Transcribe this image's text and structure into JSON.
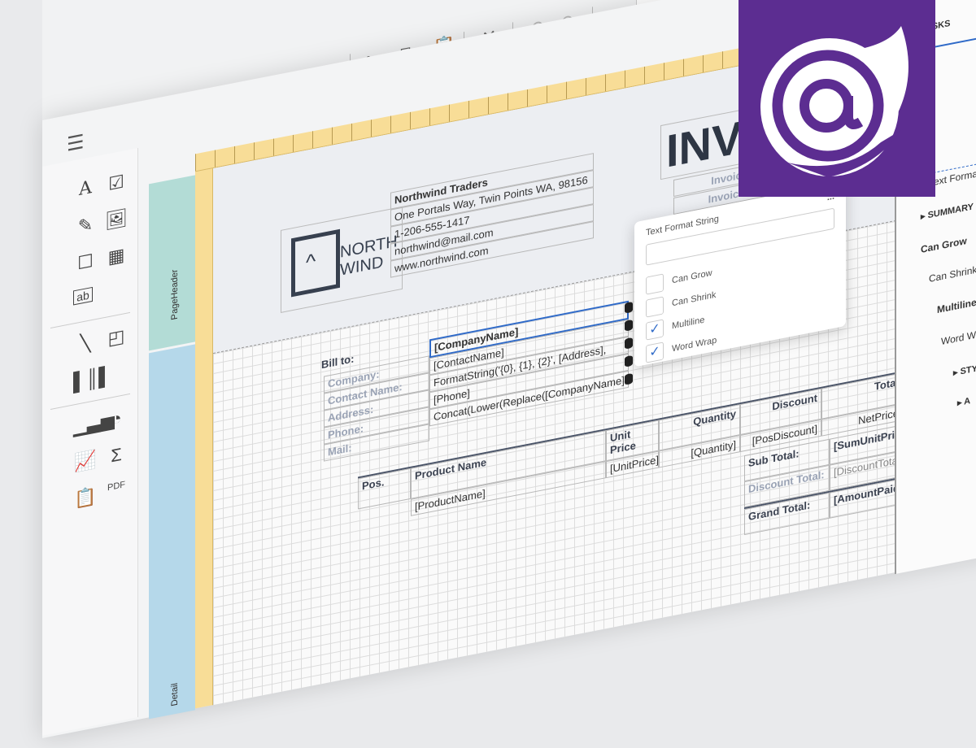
{
  "toolbar": {
    "icons": [
      "cut-icon",
      "copy-icon",
      "paste-icon",
      "delete-icon",
      "undo-icon",
      "redo-icon",
      "zoom-out-icon"
    ]
  },
  "toolbox": {
    "icons": [
      "label-icon",
      "checkbox-icon",
      "rich-text-icon",
      "picture-icon",
      "panel-icon",
      "table-icon",
      "character-comb-icon",
      "line-icon",
      "shape-icon",
      "barcode-icon",
      "chart-icon",
      "gauge-icon",
      "sparkline-icon",
      "summary-icon",
      "subreport-icon",
      "pdf-content-icon"
    ]
  },
  "bands": {
    "page_header": "PageHeader",
    "detail": "Detail"
  },
  "company": {
    "logo_top": "NORTH",
    "logo_bottom": "WIND",
    "name": "Northwind Traders",
    "address": "One Portals Way, Twin Points WA, 98156",
    "phone": "1-206-555-1417",
    "email": "northwind@mail.com",
    "web": "www.northwind.com"
  },
  "invoice": {
    "title": "INVOICE",
    "row1": "Invoic",
    "row2": "Invoice"
  },
  "bill": {
    "title": "Bill to:",
    "labels": [
      "Company:",
      "Contact Name:",
      "Address:",
      "Phone:",
      "Mail:"
    ],
    "fields": [
      "[CompanyName]",
      "[ContactName]",
      "FormatString('{0}, {1}, {2}', [Address],",
      "[Phone]",
      "Concat(Lower(Replace([CompanyName],"
    ]
  },
  "table": {
    "headers": [
      "Pos.",
      "Product Name",
      "Unit Price",
      "Quantity",
      "Discount",
      "Total"
    ],
    "values": [
      "[ProductName]",
      "[UnitPrice]",
      "[Quantity]",
      "[PosDiscount]",
      "NetPrice"
    ]
  },
  "totals": {
    "labels": [
      "Sub Total:",
      "Discount Total:",
      "Grand Total:"
    ],
    "values": [
      "[SumUnitPrice]",
      "[DiscountTotal]",
      "[AmountPaid]"
    ]
  },
  "popup": {
    "title": "Text Format String",
    "more": "...",
    "value": "",
    "options": [
      {
        "label": "Can Grow",
        "checked": false
      },
      {
        "label": "Can Shrink",
        "checked": false
      },
      {
        "label": "Multiline",
        "checked": true
      },
      {
        "label": "Word Wrap",
        "checked": true
      }
    ]
  },
  "props": {
    "tasks": "TASKS",
    "format": "Text Format String",
    "summary": "SUMMARY",
    "can_grow": "Can Grow",
    "can_shrink": "Can Shrink",
    "multiline": "Multiline",
    "word_wrap": "Word Wrap",
    "styles": "STYLES",
    "appearance": "A"
  },
  "brand": {
    "color": "#5c2d91",
    "name": "Blazor"
  }
}
